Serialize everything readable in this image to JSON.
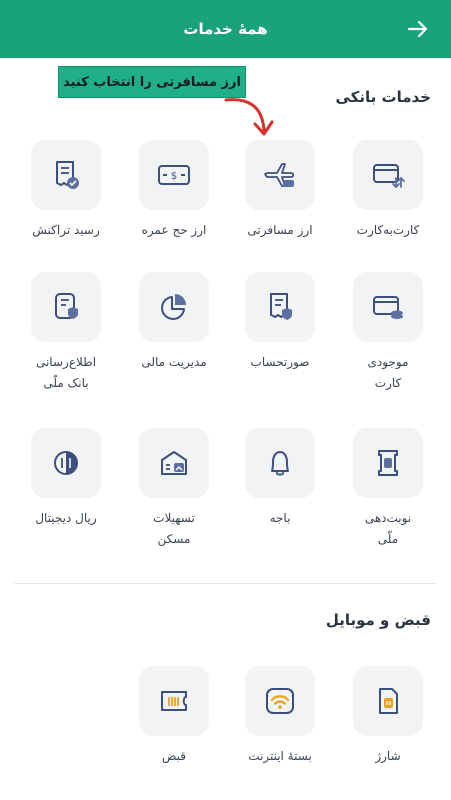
{
  "header": {
    "title": "همهٔ خدمات"
  },
  "annotation": {
    "text": "ارز مسافرتی را انتخاب کنید"
  },
  "banking": {
    "title": "خدمات بانکی",
    "items": [
      {
        "label": "کارت‌به‌کارت",
        "icon": "card-transfer-icon"
      },
      {
        "label": "ارز مسافرتی",
        "icon": "airplane-icon"
      },
      {
        "label": "ارز حج عمره",
        "icon": "banknote-icon"
      },
      {
        "label": "رسید تراکنش",
        "icon": "receipt-icon"
      },
      {
        "label": "موجودی\nکارت",
        "icon": "card-balance-icon"
      },
      {
        "label": "صورتحساب",
        "icon": "statement-icon"
      },
      {
        "label": "مدیریت مالی",
        "icon": "pie-chart-icon"
      },
      {
        "label": "اطلاع‌رسانی\nبانک ملّی",
        "icon": "notify-doc-icon"
      },
      {
        "label": "نوبت‌دهی\nملّی",
        "icon": "ticket-icon"
      },
      {
        "label": "باجه",
        "icon": "bell-icon"
      },
      {
        "label": "تسهیلات\nمسکن",
        "icon": "house-loan-icon"
      },
      {
        "label": "ریال دیجیتال",
        "icon": "digital-rial-icon"
      }
    ]
  },
  "bills": {
    "title": "قبض و موبایل",
    "items": [
      {
        "label": "شارژ",
        "icon": "sim-card-icon"
      },
      {
        "label": "بستهٔ اینترنت",
        "icon": "wifi-icon"
      },
      {
        "label": "قبض",
        "icon": "bill-icon"
      }
    ]
  },
  "colors": {
    "primary": "#1aa27a",
    "icon_blue": "#3d4f7e",
    "icon_orange": "#f0a01a",
    "annotation_arrow": "#d8312b"
  }
}
